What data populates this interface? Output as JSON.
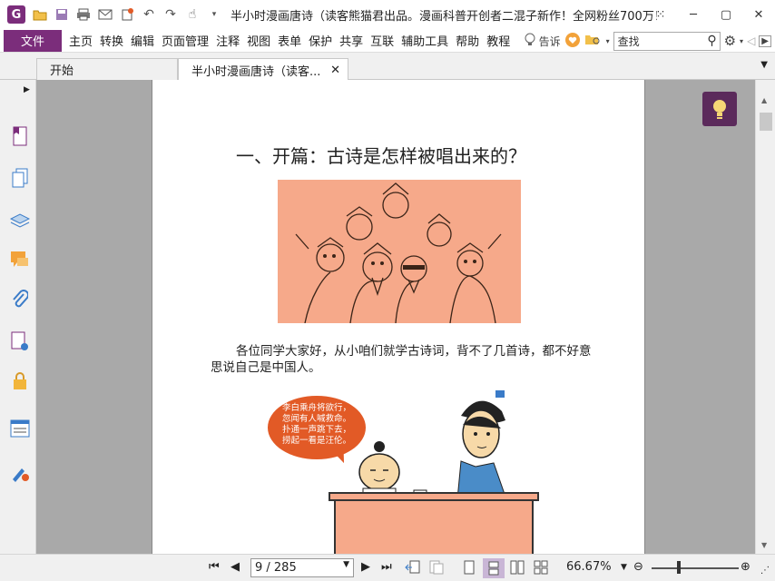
{
  "titlebar": {
    "app_logo_letter": "G",
    "title": "半小时漫画唐诗（读客熊猫君出品。漫画科普开创者二混子新作！全网粉丝700万！"
  },
  "menubar": {
    "file_label": "文件",
    "items": [
      "主页",
      "转换",
      "编辑",
      "页面管理",
      "注释",
      "视图",
      "表单",
      "保护",
      "共享",
      "互联",
      "辅助工具",
      "帮助",
      "教程"
    ],
    "tell_me": "告诉",
    "search_placeholder": "查找"
  },
  "tabs": [
    {
      "label": "开始"
    },
    {
      "label": "半小时漫画唐诗（读客...",
      "close": "✕"
    }
  ],
  "document": {
    "chapter_title": "一、开篇：古诗是怎样被唱出来的？",
    "paragraph": "各位同学大家好，从小咱们就学古诗词，背不了几首诗，都不好意思说自己是中国人。",
    "bubble_lines": [
      "李白乘舟将欲行，",
      "忽闻有人喊救命。",
      "扑通一声跳下去，",
      "捞起一看是汪伦。"
    ]
  },
  "statusbar": {
    "page_value": "9 / 285",
    "zoom": "66.67%"
  },
  "colors": {
    "accent": "#7b2d7b",
    "illustration_bg": "#f6a98a",
    "bubble": "#e25a26"
  }
}
